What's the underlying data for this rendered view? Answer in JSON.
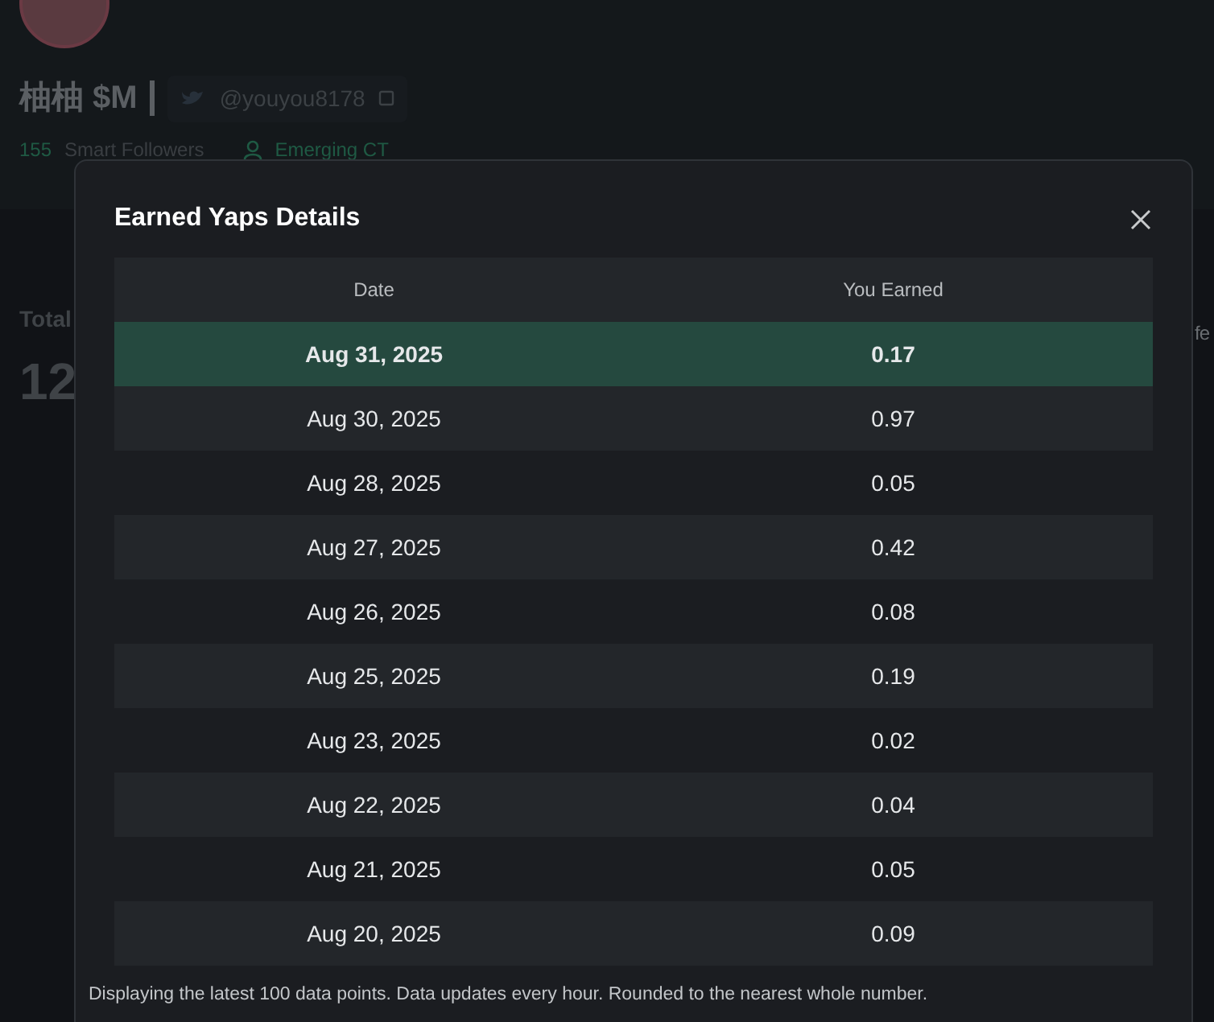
{
  "profile": {
    "name": "柚柚 $M",
    "handle": "@youyou8178",
    "smart_followers_count": "155",
    "smart_followers_label": "Smart Followers",
    "tier": "Emerging CT"
  },
  "stats": {
    "label": "Total",
    "value": "12",
    "right_label": "fe"
  },
  "modal": {
    "title": "Earned Yaps Details",
    "table": {
      "columns": [
        "Date",
        "You Earned"
      ],
      "rows": [
        {
          "date": "Aug 31, 2025",
          "earned": "0.17",
          "selected": true
        },
        {
          "date": "Aug 30, 2025",
          "earned": "0.97",
          "selected": false
        },
        {
          "date": "Aug 28, 2025",
          "earned": "0.05",
          "selected": false
        },
        {
          "date": "Aug 27, 2025",
          "earned": "0.42",
          "selected": false
        },
        {
          "date": "Aug 26, 2025",
          "earned": "0.08",
          "selected": false
        },
        {
          "date": "Aug 25, 2025",
          "earned": "0.19",
          "selected": false
        },
        {
          "date": "Aug 23, 2025",
          "earned": "0.02",
          "selected": false
        },
        {
          "date": "Aug 22, 2025",
          "earned": "0.04",
          "selected": false
        },
        {
          "date": "Aug 21, 2025",
          "earned": "0.05",
          "selected": false
        },
        {
          "date": "Aug 20, 2025",
          "earned": "0.09",
          "selected": false
        }
      ]
    },
    "footnote": "Displaying the latest 100 data points. Data updates every hour. Rounded to the nearest whole number."
  }
}
